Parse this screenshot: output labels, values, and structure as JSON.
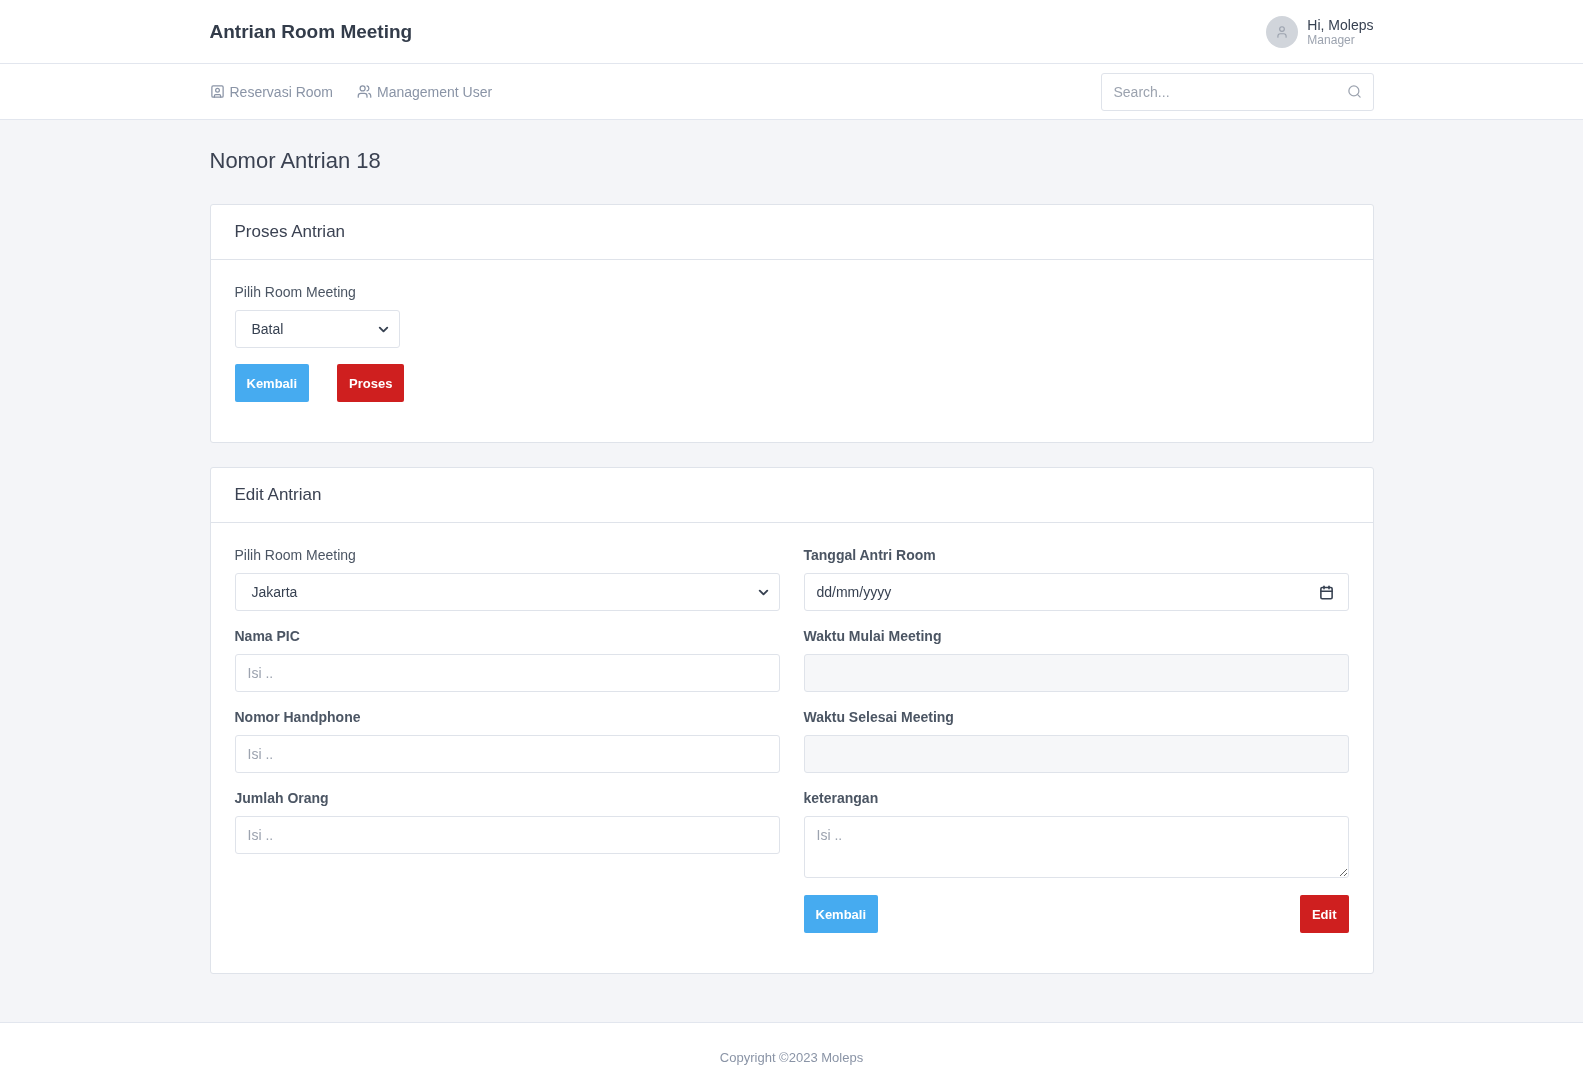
{
  "header": {
    "title": "Antrian Room Meeting",
    "user": {
      "greeting": "Hi, Moleps",
      "role": "Manager"
    }
  },
  "nav": {
    "items": [
      {
        "label": "Reservasi Room"
      },
      {
        "label": "Management User"
      }
    ],
    "search": {
      "placeholder": "Search..."
    }
  },
  "page_title": "Nomor Antrian 18",
  "proses_card": {
    "title": "Proses Antrian",
    "label": "Pilih Room Meeting",
    "select_value": "Batal",
    "buttons": [
      {
        "label": "Kembali",
        "kind": "info"
      },
      {
        "label": "Proses",
        "kind": "danger"
      }
    ]
  },
  "edit_card": {
    "title": "Edit Antrian",
    "left_fields": [
      {
        "kind": "select",
        "label": "Pilih Room Meeting",
        "value": "Jakarta"
      },
      {
        "kind": "text",
        "label": "Nama PIC",
        "placeholder": "Isi .."
      },
      {
        "kind": "text",
        "label": "Nomor Handphone",
        "placeholder": "Isi .."
      },
      {
        "kind": "text",
        "label": "Jumlah Orang",
        "placeholder": "Isi .."
      }
    ],
    "right_fields": [
      {
        "kind": "date",
        "label": "Tanggal Antri Room",
        "value": "dd/mm/yyyy"
      },
      {
        "kind": "readonly",
        "label": "Waktu Mulai Meeting"
      },
      {
        "kind": "readonly",
        "label": "Waktu Selesai Meeting"
      },
      {
        "kind": "textarea",
        "label": "keterangan",
        "placeholder": "Isi .."
      }
    ],
    "buttons": [
      {
        "label": "Kembali",
        "kind": "info"
      },
      {
        "label": "Edit",
        "kind": "danger"
      }
    ]
  },
  "footer": "Copyright ©2023 Moleps"
}
